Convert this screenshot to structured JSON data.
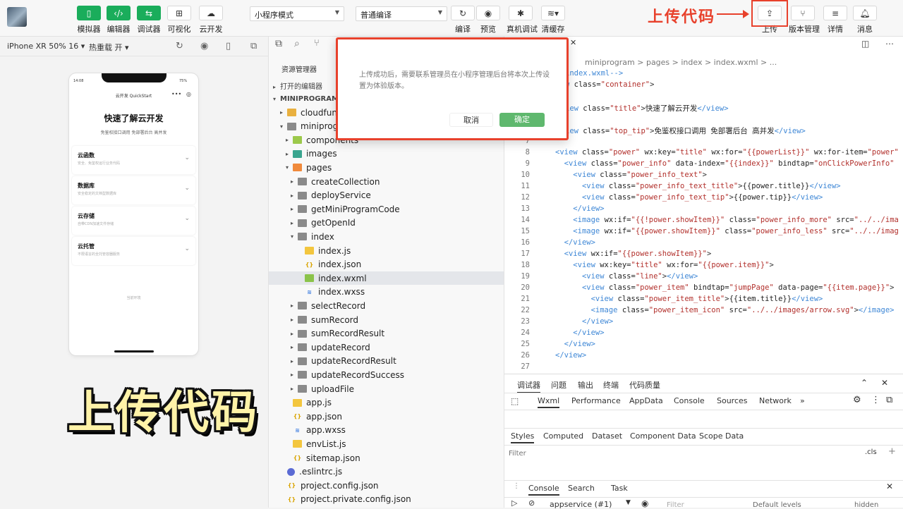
{
  "toolbar": {
    "buttons_left": [
      {
        "label": "模拟器",
        "icon": "phone-icon"
      },
      {
        "label": "编辑器",
        "icon": "code-icon"
      },
      {
        "label": "调试器",
        "icon": "debug-icon"
      },
      {
        "label": "可视化",
        "icon": "layout-icon"
      },
      {
        "label": "云开发",
        "icon": "cloud-icon"
      }
    ],
    "mode_select": "小程序模式",
    "compile_select": "普通编译",
    "buttons_mid": [
      {
        "label": "编译",
        "icon": "refresh-icon"
      },
      {
        "label": "预览",
        "icon": "eye-icon"
      },
      {
        "label": "真机调试",
        "icon": "bug-icon"
      },
      {
        "label": "清缓存",
        "icon": "layers-icon"
      }
    ],
    "buttons_right": [
      {
        "label": "上传",
        "icon": "upload-icon"
      },
      {
        "label": "版本管理",
        "icon": "branch-icon"
      },
      {
        "label": "详情",
        "icon": "menu-icon"
      },
      {
        "label": "消息",
        "icon": "bell-icon"
      }
    ],
    "annotation": "上传代码"
  },
  "simulator": {
    "device": "iPhone XR 50% 16 ▾",
    "hot_reload": "热重载 开 ▾",
    "phone": {
      "time": "14:08",
      "battery": "75%",
      "nav_title": "云开发 QuickStart",
      "title": "快速了解云开发",
      "tip": "免鉴权接口调用 免部署后台 高并发",
      "cards": [
        {
          "title": "云函数",
          "sub": "安全、免鉴权运行业务代码"
        },
        {
          "title": "数据库",
          "sub": "安全稳定的文档型数据库"
        },
        {
          "title": "云存储",
          "sub": "自带CDN加速文件存储"
        },
        {
          "title": "云托管",
          "sub": "不限语言的全托管容器服务"
        }
      ],
      "env": "当前环境"
    }
  },
  "explorer": {
    "title": "资源管理器",
    "open_editors": "打开的编辑器",
    "project": "MINIPROGRAM",
    "items": [
      {
        "label": "cloudfunctions",
        "level": 1,
        "type": "folder-yel",
        "tw": "▸"
      },
      {
        "label": "miniprogram",
        "level": 1,
        "type": "folder",
        "tw": "▾"
      },
      {
        "label": "components",
        "level": 2,
        "type": "folder-grn",
        "tw": "▸"
      },
      {
        "label": "images",
        "level": 2,
        "type": "folder-teal",
        "tw": "▸"
      },
      {
        "label": "pages",
        "level": 2,
        "type": "folder-ora",
        "tw": "▾"
      },
      {
        "label": "createCollection",
        "level": 3,
        "type": "folder",
        "tw": "▸"
      },
      {
        "label": "deployService",
        "level": 3,
        "type": "folder",
        "tw": "▸"
      },
      {
        "label": "getMiniProgramCode",
        "level": 3,
        "type": "folder",
        "tw": "▸"
      },
      {
        "label": "getOpenId",
        "level": 3,
        "type": "folder",
        "tw": "▸"
      },
      {
        "label": "index",
        "level": 3,
        "type": "folder",
        "tw": "▾"
      },
      {
        "label": "index.js",
        "level": 4,
        "type": "js",
        "tw": ""
      },
      {
        "label": "index.json",
        "level": 4,
        "type": "json",
        "tw": ""
      },
      {
        "label": "index.wxml",
        "level": 4,
        "type": "wxml",
        "tw": ""
      },
      {
        "label": "index.wxss",
        "level": 4,
        "type": "wxss",
        "tw": ""
      },
      {
        "label": "selectRecord",
        "level": 3,
        "type": "folder",
        "tw": "▸"
      },
      {
        "label": "sumRecord",
        "level": 3,
        "type": "folder",
        "tw": "▸"
      },
      {
        "label": "sumRecordResult",
        "level": 3,
        "type": "folder",
        "tw": "▸"
      },
      {
        "label": "updateRecord",
        "level": 3,
        "type": "folder",
        "tw": "▸"
      },
      {
        "label": "updateRecordResult",
        "level": 3,
        "type": "folder",
        "tw": "▸"
      },
      {
        "label": "updateRecordSuccess",
        "level": 3,
        "type": "folder",
        "tw": "▸"
      },
      {
        "label": "uploadFile",
        "level": 3,
        "type": "folder",
        "tw": "▸"
      },
      {
        "label": "app.js",
        "level": 2,
        "type": "js",
        "tw": ""
      },
      {
        "label": "app.json",
        "level": 2,
        "type": "json",
        "tw": ""
      },
      {
        "label": "app.wxss",
        "level": 2,
        "type": "wxss",
        "tw": ""
      },
      {
        "label": "envList.js",
        "level": 2,
        "type": "js",
        "tw": ""
      },
      {
        "label": "sitemap.json",
        "level": 2,
        "type": "json",
        "tw": ""
      },
      {
        "label": ".eslintrc.js",
        "level": 1,
        "type": "dot",
        "tw": ""
      },
      {
        "label": "project.config.json",
        "level": 1,
        "type": "json",
        "tw": ""
      },
      {
        "label": "project.private.config.json",
        "level": 1,
        "type": "json",
        "tw": ""
      }
    ],
    "selected": "index.wxml"
  },
  "editor": {
    "breadcrumb": "miniprogram > pages > index > index.wxml > ...",
    "lines": [
      {
        "n": "",
        "html": "<span class='tg'>index.wxml--></span>"
      },
      {
        "n": "",
        "html": "<span class='tg'>w</span> <span class='at'>class=</span><span class='st'>\"container\"</span><span class='br'>></span>"
      },
      {
        "n": "",
        "html": ""
      },
      {
        "n": "",
        "html": "<span class='tg'>iew</span> <span class='at'>class=</span><span class='st'>\"title\"</span><span class='br'>></span>快速了解云开发<span class='tg'>&lt;/view></span>"
      },
      {
        "n": "",
        "html": ""
      },
      {
        "n": "",
        "html": "<span class='tg'>iew</span> <span class='at'>class=</span><span class='st'>\"top_tip\"</span><span class='br'>></span>免鉴权接口调用 免部署后台 高并发<span class='tg'>&lt;/view></span>"
      },
      {
        "n": "7",
        "html": ""
      },
      {
        "n": "8",
        "html": "<span class='tg'>&lt;view</span> <span class='at'>class=</span><span class='st'>\"power\"</span> <span class='at'>wx:key=</span><span class='st'>\"title\"</span> <span class='at'>wx:for=</span><span class='st'>\"{{powerList}}\"</span> <span class='at'>wx:for-item=</span><span class='st'>\"power\"</span>"
      },
      {
        "n": "9",
        "html": "  <span class='tg'>&lt;view</span> <span class='at'>class=</span><span class='st'>\"power_info\"</span> <span class='at'>data-index=</span><span class='st'>\"{{index}}\"</span> <span class='at'>bindtap=</span><span class='st'>\"onClickPowerInfo\"</span>"
      },
      {
        "n": "10",
        "html": "    <span class='tg'>&lt;view</span> <span class='at'>class=</span><span class='st'>\"power_info_text\"</span><span class='br'>></span>"
      },
      {
        "n": "11",
        "html": "      <span class='tg'>&lt;view</span> <span class='at'>class=</span><span class='st'>\"power_info_text_title\"</span><span class='br'>></span>{{power.title}}<span class='tg'>&lt;/view></span>"
      },
      {
        "n": "12",
        "html": "      <span class='tg'>&lt;view</span> <span class='at'>class=</span><span class='st'>\"power_info_text_tip\"</span><span class='br'>></span>{{power.tip}}<span class='tg'>&lt;/view></span>"
      },
      {
        "n": "13",
        "html": "    <span class='tg'>&lt;/view></span>"
      },
      {
        "n": "14",
        "html": "    <span class='tg'>&lt;image</span> <span class='at'>wx:if=</span><span class='st'>\"{{!power.showItem}}\"</span> <span class='at'>class=</span><span class='st'>\"power_info_more\"</span> <span class='at'>src=</span><span class='st'>\"../../ima</span>"
      },
      {
        "n": "15",
        "html": "    <span class='tg'>&lt;image</span> <span class='at'>wx:if=</span><span class='st'>\"{{power.showItem}}\"</span> <span class='at'>class=</span><span class='st'>\"power_info_less\"</span> <span class='at'>src=</span><span class='st'>\"../../imag</span>"
      },
      {
        "n": "16",
        "html": "  <span class='tg'>&lt;/view></span>"
      },
      {
        "n": "17",
        "html": "  <span class='tg'>&lt;view</span> <span class='at'>wx:if=</span><span class='st'>\"{{power.showItem}}\"</span><span class='br'>></span>"
      },
      {
        "n": "18",
        "html": "    <span class='tg'>&lt;view</span> <span class='at'>wx:key=</span><span class='st'>\"title\"</span> <span class='at'>wx:for=</span><span class='st'>\"{{power.item}}\"</span><span class='br'>></span>"
      },
      {
        "n": "19",
        "html": "      <span class='tg'>&lt;view</span> <span class='at'>class=</span><span class='st'>\"line\"</span><span class='br'>></span><span class='tg'>&lt;/view></span>"
      },
      {
        "n": "20",
        "html": "      <span class='tg'>&lt;view</span> <span class='at'>class=</span><span class='st'>\"power_item\"</span> <span class='at'>bindtap=</span><span class='st'>\"jumpPage\"</span> <span class='at'>data-page=</span><span class='st'>\"{{item.page}}\"</span><span class='br'>></span>"
      },
      {
        "n": "21",
        "html": "        <span class='tg'>&lt;view</span> <span class='at'>class=</span><span class='st'>\"power_item_title\"</span><span class='br'>></span>{{item.title}}<span class='tg'>&lt;/view></span>"
      },
      {
        "n": "22",
        "html": "        <span class='tg'>&lt;image</span> <span class='at'>class=</span><span class='st'>\"power_item_icon\"</span> <span class='at'>src=</span><span class='st'>\"../../images/arrow.svg\"</span><span class='br'>></span><span class='tg'>&lt;/image></span>"
      },
      {
        "n": "23",
        "html": "      <span class='tg'>&lt;/view></span>"
      },
      {
        "n": "24",
        "html": "    <span class='tg'>&lt;/view></span>"
      },
      {
        "n": "25",
        "html": "  <span class='tg'>&lt;/view></span>"
      },
      {
        "n": "26",
        "html": "<span class='tg'>&lt;/view></span>"
      },
      {
        "n": "27",
        "html": ""
      }
    ]
  },
  "debugger": {
    "top_tabs": [
      "调试器",
      "问题",
      "输出",
      "终端",
      "代码质量"
    ],
    "panel_tabs": [
      "Wxml",
      "Performance",
      "AppData",
      "Console",
      "Sources",
      "Network",
      "»"
    ],
    "style_tabs": [
      "Styles",
      "Computed",
      "Dataset",
      "Component Data",
      "Scope Data"
    ],
    "filter_placeholder": "Filter",
    "cls": ".cls",
    "console_tabs": [
      "Console",
      "Search",
      "Task"
    ],
    "context": "appservice (#1)",
    "levels": "Default levels",
    "hidden": "hidden",
    "filter2": "Filter"
  },
  "modal": {
    "message": "上传成功后，需要联系管理员在小程序管理后台将本次上传设置为体验版本。",
    "cancel": "取消",
    "confirm": "确定"
  },
  "caption": "上传代码",
  "colors": {
    "accent_green": "#1aad5b",
    "annotation_red": "#e8412c",
    "caption_yellow": "#fff3a8"
  }
}
